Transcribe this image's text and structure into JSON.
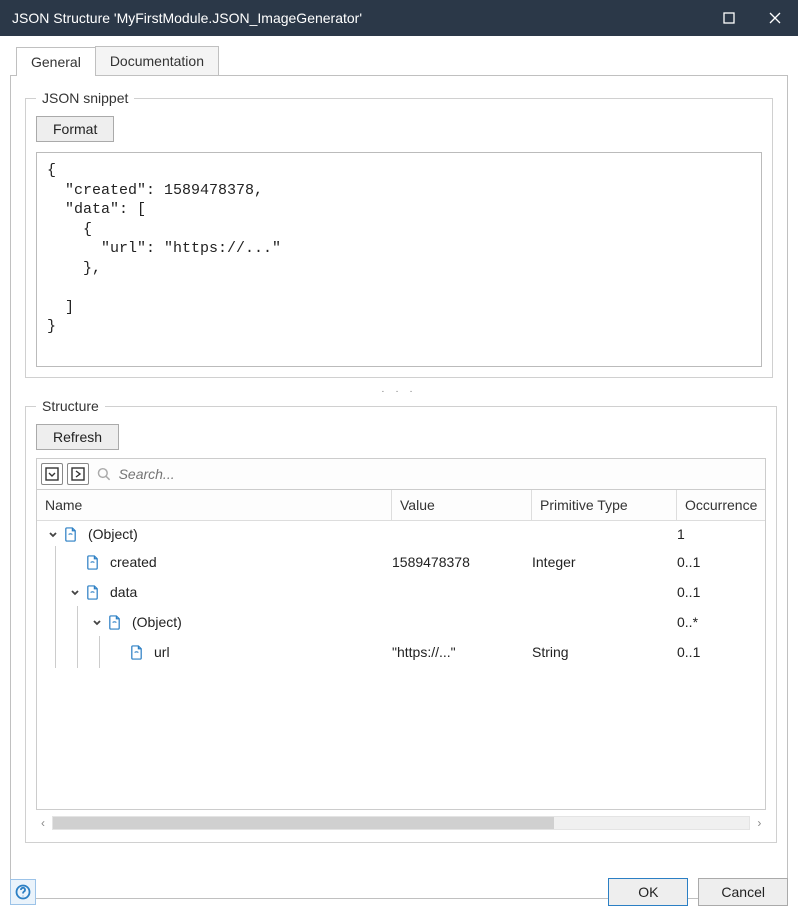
{
  "window": {
    "title": "JSON Structure 'MyFirstModule.JSON_ImageGenerator'"
  },
  "tabs": {
    "general": "General",
    "documentation": "Documentation"
  },
  "snippet": {
    "legend": "JSON snippet",
    "format_btn": "Format",
    "code": "{\n  \"created\": 1589478378,\n  \"data\": [\n    {\n      \"url\": \"https://...\"\n    },\n\n  ]\n}"
  },
  "structure": {
    "legend": "Structure",
    "refresh_btn": "Refresh",
    "search_placeholder": "Search...",
    "columns": {
      "name": "Name",
      "value": "Value",
      "type": "Primitive Type",
      "occ": "Occurrence"
    },
    "rows": [
      {
        "indent": 0,
        "expand": true,
        "label": "(Object)",
        "value": "",
        "type": "",
        "occ": "1"
      },
      {
        "indent": 1,
        "expand": false,
        "label": "created",
        "value": "1589478378",
        "type": "Integer",
        "occ": "0..1"
      },
      {
        "indent": 1,
        "expand": true,
        "label": "data",
        "value": "",
        "type": "",
        "occ": "0..1"
      },
      {
        "indent": 2,
        "expand": true,
        "label": "(Object)",
        "value": "",
        "type": "",
        "occ": "0..*"
      },
      {
        "indent": 3,
        "expand": false,
        "label": "url",
        "value": "\"https://...\"",
        "type": "String",
        "occ": "0..1"
      }
    ]
  },
  "footer": {
    "ok": "OK",
    "cancel": "Cancel"
  }
}
